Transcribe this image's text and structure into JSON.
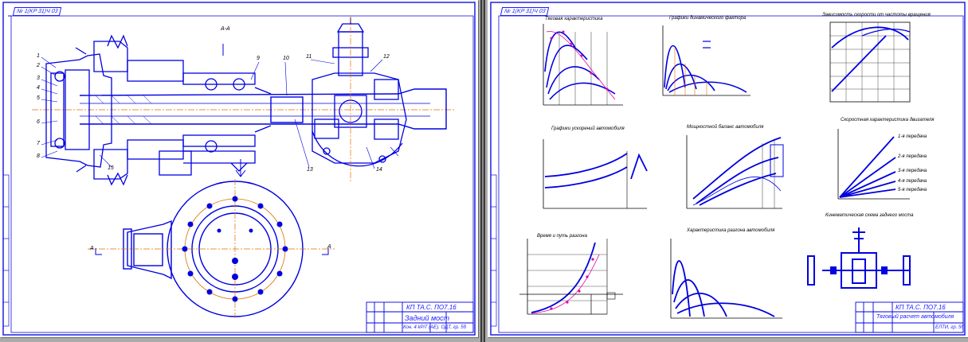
{
  "sheets": [
    {
      "id": "left",
      "stamp_tag": "№ 1(KP 31)Ч 03",
      "section_mark": "А-А",
      "view_marks": [
        "А",
        "А"
      ],
      "callouts": [
        "1",
        "2",
        "3",
        "4",
        "5",
        "6",
        "7",
        "8",
        "9",
        "10",
        "11",
        "12",
        "13",
        "14",
        "15"
      ],
      "title_block": {
        "doc_code": "КП ТА.С. ПО7.16",
        "title": "Задний мост",
        "group": "Кон. 4 kPiT (АЕ). ОДТ, гр. 5б"
      }
    },
    {
      "id": "right",
      "stamp_tag": "№ 1(KP 31)Ч 03",
      "chart_titles": [
        "Тяговая характеристика",
        "Графики динамического фактора",
        "Зависимость скорости от частоты вращения",
        "Графики ускорений автомобиля",
        "Мощностной баланс автомобиля",
        "Скоростная характеристика двигателя",
        "Время и путь разгона",
        "Характеристика разгона автомобиля",
        "Кинематическая схема заднего моста"
      ],
      "series_labels": [
        "1-я передача",
        "2-я передача",
        "3-я передача",
        "4-я передача",
        "5-я передача"
      ],
      "title_block": {
        "doc_code": "КП ТА.С. ПО7.16",
        "title": "Тяговый расчет автомобиля",
        "group": "ЕЛТИ, гр. 5б"
      }
    }
  ],
  "colors": {
    "sheet_background": "#ffffff",
    "line_ink": "#0000e0",
    "axis_ink": "#000000",
    "accent_orange": "#e07000",
    "accent_magenta": "#e000a0",
    "desk_background": "#ababab"
  }
}
